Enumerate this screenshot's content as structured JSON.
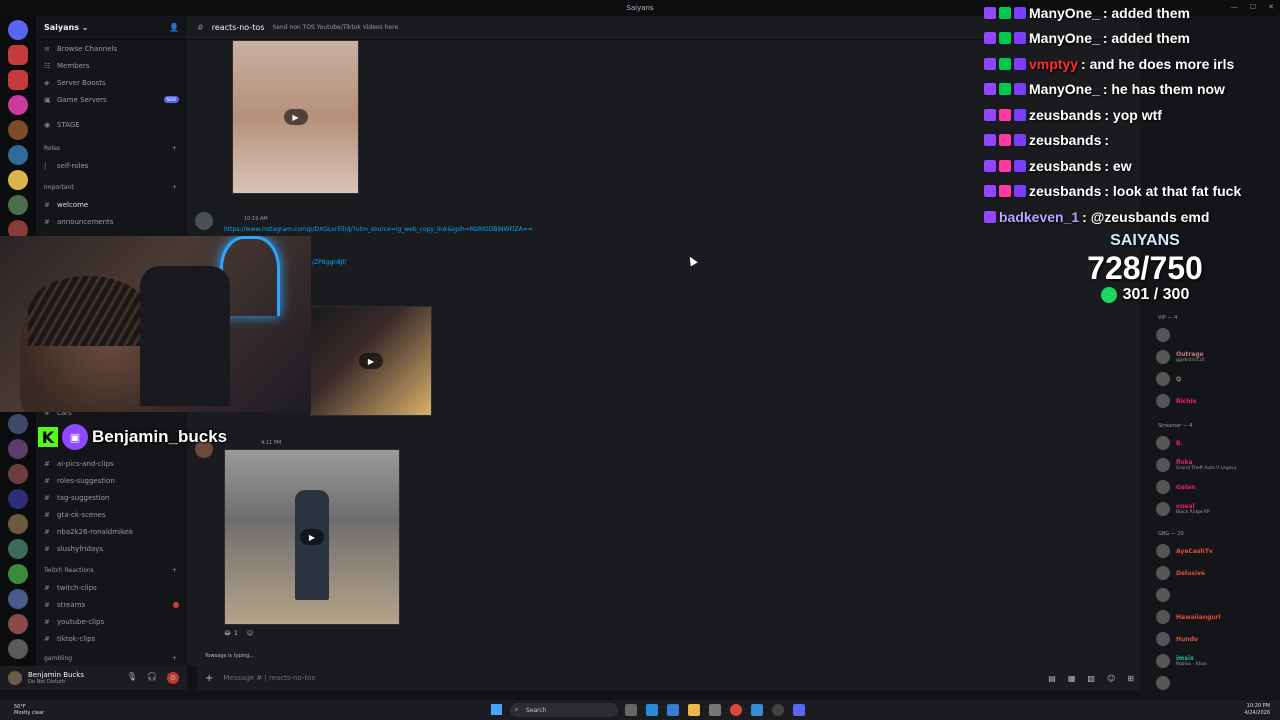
{
  "window": {
    "title": "Saiyans"
  },
  "server": {
    "name": "Saiyans",
    "items": [
      "Browse Channels",
      "Members",
      "Server Boosts",
      "Game Servers",
      "STAGE"
    ],
    "new_badge": "NEW"
  },
  "categories": {
    "roles": "Roles",
    "important": "Important",
    "twitch": "Twitch Reactions",
    "gambling": "gambling"
  },
  "channels": {
    "roles": [
      "self-roles"
    ],
    "important": [
      "welcome",
      "announcements"
    ],
    "lower": [
      "cars",
      "ai-pics-and-clips",
      "roles-suggestion",
      "tag-suggestion",
      "gta-ck-scenes",
      "nba2k26-ronaldmikek",
      "slushyfridays"
    ],
    "twitch": [
      "twitch-clips",
      "streams",
      "youtube-clips",
      "tiktok-clips"
    ]
  },
  "user": {
    "name": "Benjamin Bucks",
    "status": "Do Not Disturb"
  },
  "channel_header": {
    "name": "reacts-no-tos",
    "topic": "Send non TOS Youtube/Tiktok Videos here"
  },
  "messages": {
    "time1": "10:19 AM",
    "link1": "https://www.instagram.com/p/DXGLxrEllUJ/?utm_source=ig_web_copy_link&igsh=MzRlODBiNWFlZA==",
    "link2": "/ZP8ggn8Jf/",
    "time2": "4:11 PM",
    "reaction_count": "1"
  },
  "input": {
    "placeholder": "Message # | reacts-no-tos",
    "typing": "Yowsage is typing..."
  },
  "member_list": {
    "cat_vip": "VIP — 4",
    "cat_streamer": "Streamer — 4",
    "cat_gbg": "GBG — 20",
    "vip": [
      {
        "name": "",
        "sub": "",
        "color": "#c27c7c"
      },
      {
        "name": "Outrage",
        "sub": "gg/district10",
        "color": "#c27c7c"
      },
      {
        "name": "Q",
        "sub": "",
        "color": "#c27c7c"
      },
      {
        "name": "Richie",
        "sub": "",
        "color": "#e91e63"
      }
    ],
    "streamers": [
      {
        "name": "B.",
        "sub": "",
        "color": "#e91e63"
      },
      {
        "name": "floka",
        "sub": "Grand Theft Auto V Legacy",
        "color": "#e91e63"
      },
      {
        "name": "Galan",
        "sub": "",
        "color": "#e91e63"
      },
      {
        "name": "oneal",
        "sub": "Black Ridge RP",
        "color": "#e91e63"
      }
    ],
    "gbg": [
      {
        "name": "AyeCashTv",
        "sub": "",
        "color": "#e74c3c"
      },
      {
        "name": "Delusive",
        "sub": "",
        "color": "#e74c3c"
      },
      {
        "name": "",
        "sub": "",
        "color": "#e74c3c"
      },
      {
        "name": "Hawaiiangurl",
        "sub": "",
        "color": "#e74c3c"
      },
      {
        "name": "Hundo",
        "sub": "",
        "color": "#e74c3c"
      },
      {
        "name": "imsix",
        "sub": "Roblox - Xbox",
        "color": "#1abc9c"
      },
      {
        "name": "",
        "sub": "",
        "color": "#e74c3c"
      }
    ]
  },
  "overlay": {
    "streamer_handle": "Benjamin_bucks",
    "chat": [
      {
        "user": "ManyOne_",
        "msg": ": added them",
        "color": "#ffffff"
      },
      {
        "user": "ManyOne_",
        "msg": ": added them",
        "color": "#ffffff"
      },
      {
        "user": "vmptyy",
        "msg": ": and he does more irls",
        "color": "#ff2a2a"
      },
      {
        "user": "ManyOne_",
        "msg": ": he has them now",
        "color": "#ffffff"
      },
      {
        "user": "zeusbands",
        "msg": ": yop wtf",
        "color": "#ffffff"
      },
      {
        "user": "zeusbands",
        "msg": ":",
        "color": "#ffffff"
      },
      {
        "user": "zeusbands",
        "msg": ": ew",
        "color": "#ffffff"
      },
      {
        "user": "zeusbands",
        "msg": ": look at that fat fuck",
        "color": "#ffffff"
      },
      {
        "user": "badkeven_1",
        "msg": ": @zeusbands emd",
        "color": "#b9a4ff"
      }
    ],
    "goal_title": "SAIYANS",
    "goal_main": "728/750",
    "goal_sub": "301 / 300"
  },
  "taskbar": {
    "weather_temp": "50°F",
    "weather_desc": "Mostly clear",
    "search": "Search",
    "time": "10:20 PM",
    "date": "4/24/2026"
  }
}
